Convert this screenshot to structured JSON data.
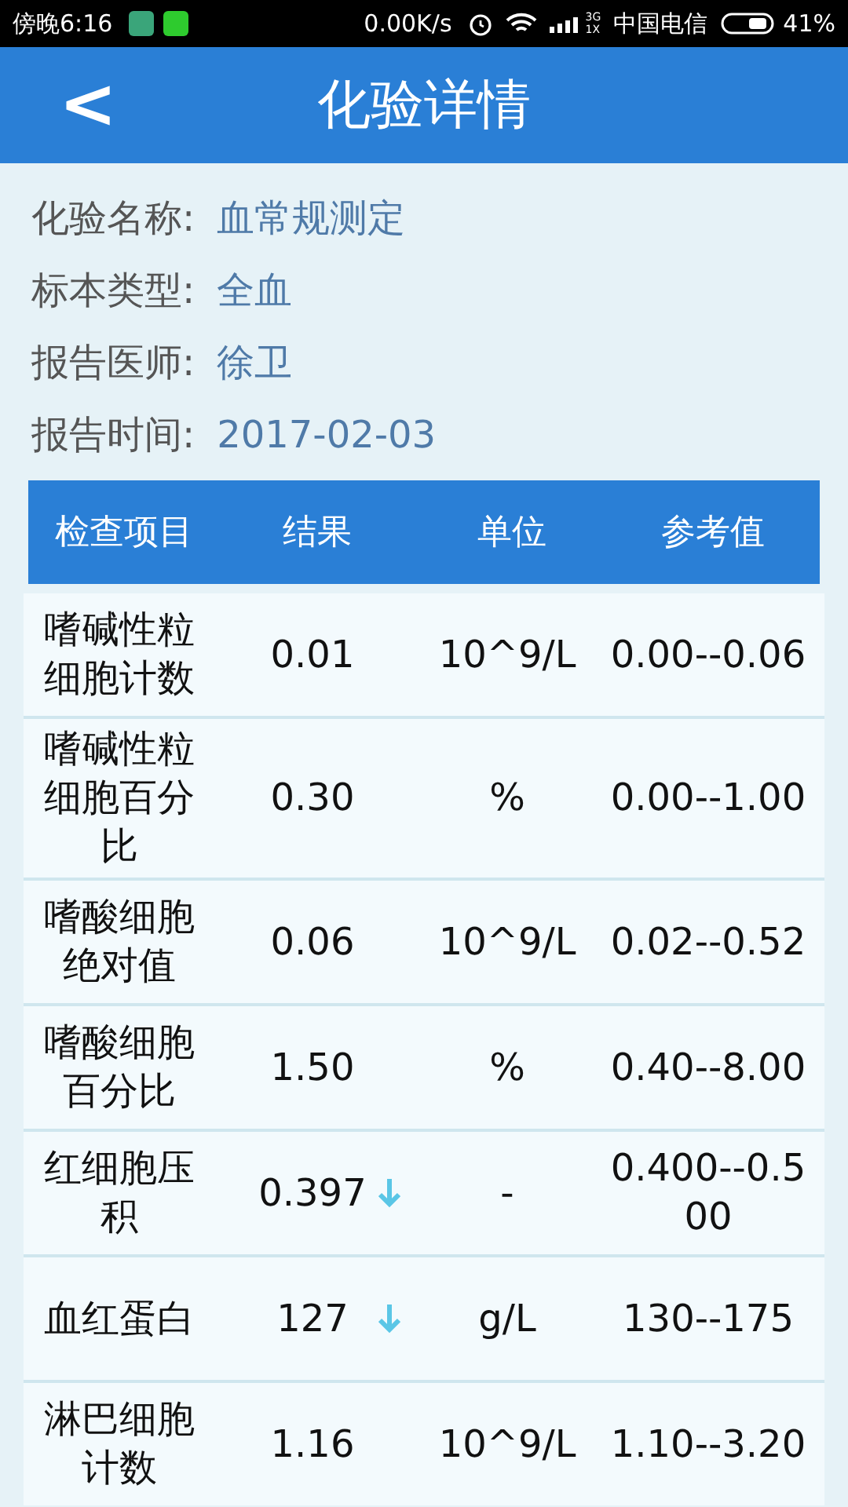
{
  "status_bar": {
    "time": "傍晚6:16",
    "speed": "0.00K/s",
    "network": [
      "3G",
      "1X"
    ],
    "carrier": "中国电信",
    "battery": "41%"
  },
  "header": {
    "back": "<",
    "title": "化验详情"
  },
  "info": [
    {
      "label": "化验名称:",
      "value": "血常规测定"
    },
    {
      "label": "标本类型:",
      "value": "全血"
    },
    {
      "label": "报告医师:",
      "value": "徐卫"
    },
    {
      "label": "报告时间:",
      "value": "2017-02-03"
    }
  ],
  "table": {
    "columns": [
      "检查项目",
      "结果",
      "单位",
      "参考值"
    ],
    "rows": [
      {
        "item": "嗜碱性粒细胞计数",
        "result": "0.01",
        "low": false,
        "unit": "10^9/L",
        "reference": "0.00--0.06"
      },
      {
        "item": "嗜碱性粒细胞百分比",
        "result": "0.30",
        "low": false,
        "unit": "%",
        "reference": "0.00--1.00"
      },
      {
        "item": "嗜酸细胞绝对值",
        "result": "0.06",
        "low": false,
        "unit": "10^9/L",
        "reference": "0.02--0.52"
      },
      {
        "item": "嗜酸细胞百分比",
        "result": "1.50",
        "low": false,
        "unit": "%",
        "reference": "0.40--8.00"
      },
      {
        "item": "红细胞压积",
        "result": "0.397",
        "low": true,
        "unit": "-",
        "reference": "0.400--0.500"
      },
      {
        "item": "血红蛋白",
        "result": "127",
        "low": true,
        "unit": "g/L",
        "reference": "130--175"
      },
      {
        "item": "淋巴细胞计数",
        "result": "1.16",
        "low": false,
        "unit": "10^9/L",
        "reference": "1.10--3.20"
      }
    ]
  }
}
